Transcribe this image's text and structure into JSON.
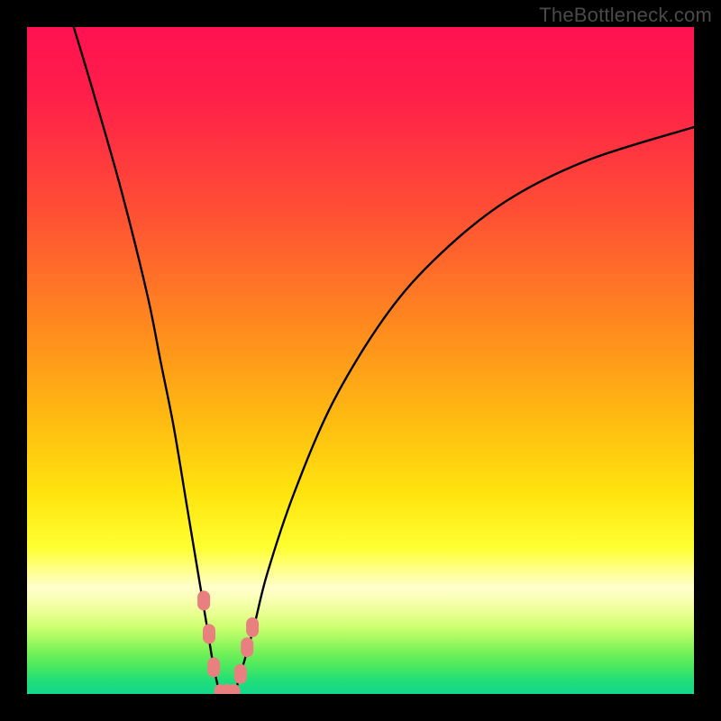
{
  "watermark": "TheBottleneck.com",
  "colors": {
    "frame_bg": "#000000",
    "watermark": "#4a4a4a",
    "curve": "#000000",
    "marker": "#e98080",
    "gradient_top": "#ff1251",
    "gradient_mid": "#ffe40e",
    "gradient_bottom": "#14d88c"
  },
  "chart_data": {
    "type": "line",
    "title": "",
    "xlabel": "",
    "ylabel": "",
    "xlim": [
      0,
      100
    ],
    "ylim": [
      0,
      100
    ],
    "grid": false,
    "legend": false,
    "series": [
      {
        "name": "bottleneck-curve",
        "x": [
          7,
          10,
          14,
          18,
          20,
          22,
          24,
          26,
          27,
          28,
          29,
          30,
          31,
          32,
          34,
          36,
          40,
          46,
          54,
          62,
          72,
          84,
          100
        ],
        "values": [
          100,
          90,
          76,
          60,
          50,
          40,
          28,
          16,
          10,
          4,
          0,
          0,
          0,
          3,
          10,
          18,
          30,
          44,
          57,
          66,
          74,
          80,
          85
        ]
      }
    ],
    "markers": [
      {
        "x": 26.5,
        "y": 14
      },
      {
        "x": 27.3,
        "y": 9
      },
      {
        "x": 28.0,
        "y": 4
      },
      {
        "x": 29.0,
        "y": 0
      },
      {
        "x": 30.0,
        "y": 0
      },
      {
        "x": 31.0,
        "y": 0
      },
      {
        "x": 32.0,
        "y": 3
      },
      {
        "x": 33.0,
        "y": 7
      },
      {
        "x": 33.8,
        "y": 10
      }
    ],
    "notes": "x and y are in percent of the plot area (0 = left/bottom, 100 = right/top). The curve dips from top-left, reaches ~0 around x≈29–31, then rises toward the upper right. Pink rounded markers cluster around the minimum (x≈27–34)."
  }
}
